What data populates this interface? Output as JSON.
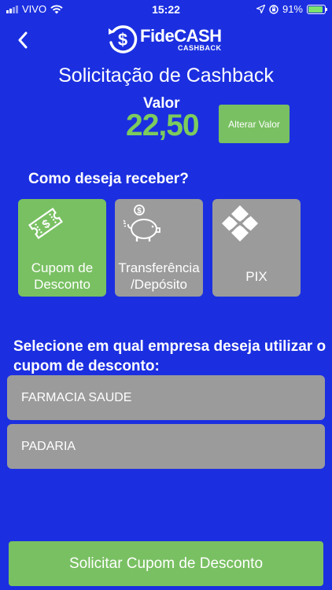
{
  "status_bar": {
    "carrier": "VIVO",
    "time": "15:22",
    "battery": "91%",
    "battery_level": 0.91
  },
  "header": {
    "brand": "FideCASH",
    "brand_sub": "CASHBACK"
  },
  "title": "Solicitação de Cashback",
  "valor": {
    "label": "Valor",
    "amount": "22,50",
    "alterar_label": "Alterar Valor"
  },
  "question": "Como deseja receber?",
  "options": [
    {
      "label": "Cupom de Desconto",
      "icon": "coupon-icon",
      "selected": true
    },
    {
      "label": "Transferência /Depósito",
      "icon": "piggy-bank-icon",
      "selected": false
    },
    {
      "label": "PIX",
      "icon": "pix-icon",
      "selected": false
    }
  ],
  "company_question": "Selecione em qual empresa deseja utilizar o cupom de desconto:",
  "companies": [
    "FARMACIA SAUDE",
    "PADARIA"
  ],
  "submit_label": "Solicitar Cupom de Desconto",
  "colors": {
    "background": "#1b2fe0",
    "accent_green": "#79c062",
    "amount_green": "#7ccb5e",
    "inactive_gray": "#9b9b9b"
  }
}
